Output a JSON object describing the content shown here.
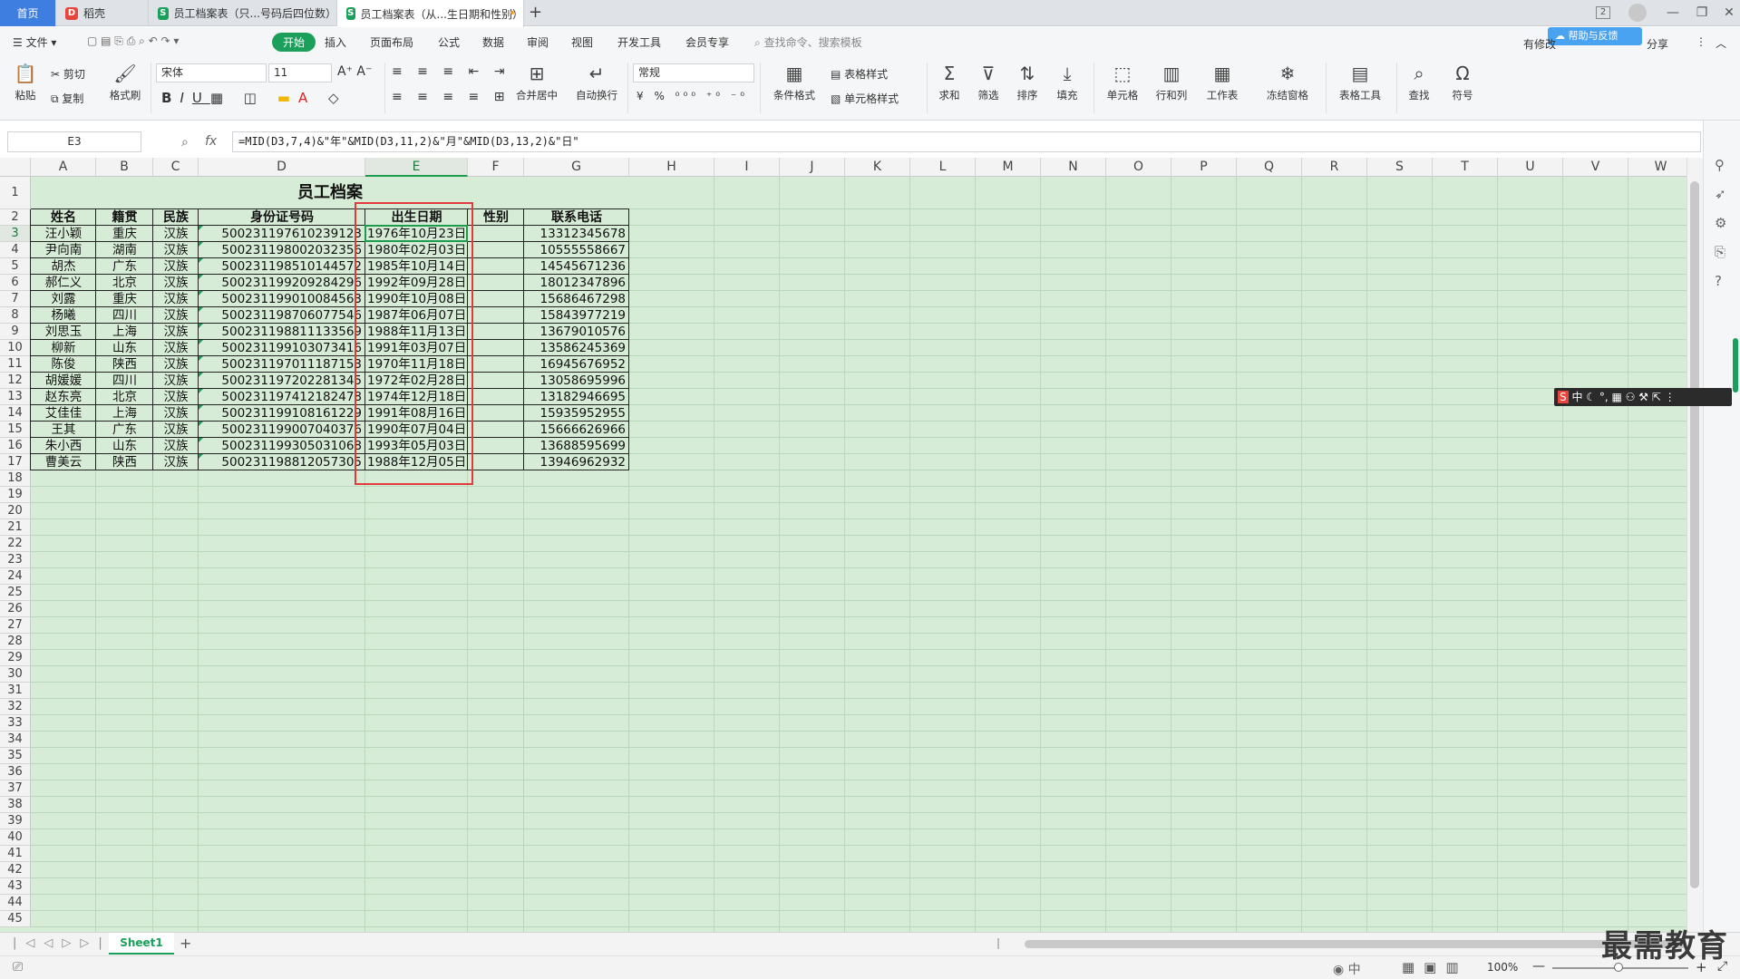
{
  "tabs": [
    {
      "label": "首页"
    },
    {
      "label": "稻壳",
      "icon": "docer-icon"
    },
    {
      "label": "员工档案表（只...号码后四位数）",
      "icon": "sheet-icon"
    },
    {
      "label": "员工档案表（从...生日期和性别）",
      "icon": "sheet-icon",
      "dot": "•"
    }
  ],
  "tab_add": "+",
  "window": {
    "badge": "2",
    "min": "—",
    "restore": "❐",
    "close": "✕"
  },
  "menu": {
    "file": "文件",
    "items": [
      "开始",
      "插入",
      "页面布局",
      "公式",
      "数据",
      "审阅",
      "视图",
      "开发工具",
      "会员专享"
    ],
    "search": "查找命令、搜索模板",
    "right": [
      "有修改",
      "分享"
    ],
    "sync_badge": "帮助与反馈"
  },
  "ribbon": {
    "paste": "粘贴",
    "cut": "剪切",
    "copy": "复制",
    "format_painter": "格式刷",
    "font_name": "宋体",
    "font_size": "11",
    "merge": "合并居中",
    "wrap": "自动换行",
    "number_format": "常规",
    "cond_format": "条件格式",
    "table_style": "表格样式",
    "cell_style": "单元格样式",
    "sum": "求和",
    "filter": "筛选",
    "sort": "排序",
    "fill": "填充",
    "cell": "单元格",
    "rowcol": "行和列",
    "worksheet": "工作表",
    "freeze": "冻结窗格",
    "table_tools": "表格工具",
    "find": "查找",
    "symbol": "符号"
  },
  "formula_bar": {
    "name_box": "E3",
    "fx": "fx",
    "formula": "=MID(D3,7,4)&\"年\"&MID(D3,11,2)&\"月\"&MID(D3,13,2)&\"日\""
  },
  "columns": [
    "A",
    "B",
    "C",
    "D",
    "E",
    "F",
    "G",
    "H",
    "I",
    "J",
    "K",
    "L",
    "M",
    "N",
    "O",
    "P",
    "Q",
    "R",
    "S",
    "T",
    "U",
    "V",
    "W"
  ],
  "sheet": {
    "title": "员工档案",
    "headers": [
      "姓名",
      "籍贯",
      "民族",
      "身份证号码",
      "出生日期",
      "性别",
      "联系电话"
    ],
    "rows": [
      [
        "汪小颖",
        "重庆",
        "汉族",
        "500231197610239123",
        "1976年10月23日",
        "",
        "13312345678"
      ],
      [
        "尹向南",
        "湖南",
        "汉族",
        "500231198002032356",
        "1980年02月03日",
        "",
        "10555558667"
      ],
      [
        "胡杰",
        "广东",
        "汉族",
        "500231198510144572",
        "1985年10月14日",
        "",
        "14545671236"
      ],
      [
        "郝仁义",
        "北京",
        "汉族",
        "500231199209284296",
        "1992年09月28日",
        "",
        "18012347896"
      ],
      [
        "刘露",
        "重庆",
        "汉族",
        "500231199010084563",
        "1990年10月08日",
        "",
        "15686467298"
      ],
      [
        "杨曦",
        "四川",
        "汉族",
        "500231198706077546",
        "1987年06月07日",
        "",
        "15843977219"
      ],
      [
        "刘思玉",
        "上海",
        "汉族",
        "500231198811133569",
        "1988年11月13日",
        "",
        "13679010576"
      ],
      [
        "柳新",
        "山东",
        "汉族",
        "500231199103073416",
        "1991年03月07日",
        "",
        "13586245369"
      ],
      [
        "陈俊",
        "陕西",
        "汉族",
        "500231197011187153",
        "1970年11月18日",
        "",
        "16945676952"
      ],
      [
        "胡媛媛",
        "四川",
        "汉族",
        "500231197202281345",
        "1972年02月28日",
        "",
        "13058695996"
      ],
      [
        "赵东亮",
        "北京",
        "汉族",
        "500231197412182478",
        "1974年12月18日",
        "",
        "13182946695"
      ],
      [
        "艾佳佳",
        "上海",
        "汉族",
        "500231199108161229",
        "1991年08月16日",
        "",
        "15935952955"
      ],
      [
        "王其",
        "广东",
        "汉族",
        "500231199007040376",
        "1990年07月04日",
        "",
        "15666626966"
      ],
      [
        "朱小西",
        "山东",
        "汉族",
        "500231199305031068",
        "1993年05月03日",
        "",
        "13688595699"
      ],
      [
        "曹美云",
        "陕西",
        "汉族",
        "500231198812057305",
        "1988年12月05日",
        "",
        "13946962932"
      ]
    ]
  },
  "sheet_tabs": [
    "Sheet1"
  ],
  "sheet_add": "+",
  "status": {
    "zoom": "100%",
    "zoom_minus": "—",
    "zoom_plus": "+",
    "ime": "中"
  },
  "watermark": "最需教育",
  "colors": {
    "accent": "#1aa05a",
    "grid_bg": "#d6ecd6",
    "highlight": "#e23b3b",
    "home_tab": "#3d7ee0"
  }
}
